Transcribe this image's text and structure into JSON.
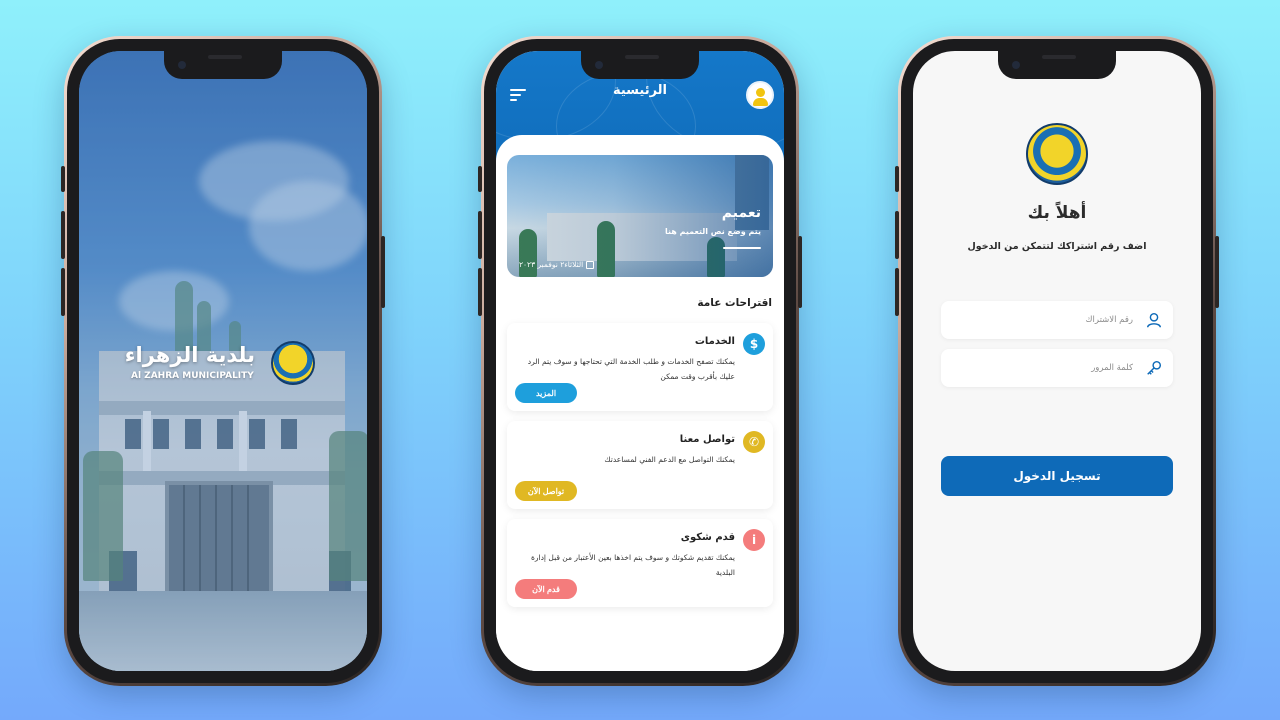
{
  "colors": {
    "primary_blue": "#0e6ab8",
    "services_blue": "#1e9fdc",
    "contact_yellow": "#e0b823",
    "complaint_red": "#f47c7c"
  },
  "splash": {
    "brand_arabic": "بلدية الزهراء",
    "brand_english": "Al ZAHRA MUNICIPALITY"
  },
  "home": {
    "title": "الرئيسية",
    "news": {
      "title": "تعميم",
      "subtitle": "يتم وضع نص التعميم هنا",
      "date": "الثلاثاء٢ نوفمبر ٢٠٢٣"
    },
    "section_title": "اقتراحات عامة",
    "cards": [
      {
        "title": "الخدمات",
        "text": "يمكنك تصفح الخدمات و طلب الخدمة التي تحتاجها و سوف يتم الرد عليك بأقرب وقت ممكن",
        "button": "المزيد",
        "icon": "services-icon"
      },
      {
        "title": "تواصل معنا",
        "text": "يمكنك التواصل مع الدعم الفني لمساعدتك",
        "button": "تواصل الآن",
        "icon": "phone-icon"
      },
      {
        "title": "قدم شكوى",
        "text": "يمكنك تقديم شكوتك و سوف يتم اخذها بعين الأعتبار من قبل إدارة البلدية",
        "button": "قدم الآن",
        "icon": "info-icon"
      }
    ]
  },
  "login": {
    "welcome": "أهلاً بك",
    "subtitle": "اضف رقم اشتراكك لتتمكن من الدخول",
    "subscription_placeholder": "رقم الاشتراك",
    "password_placeholder": "كلمة المرور",
    "login_button": "تسجيل الدخول"
  }
}
